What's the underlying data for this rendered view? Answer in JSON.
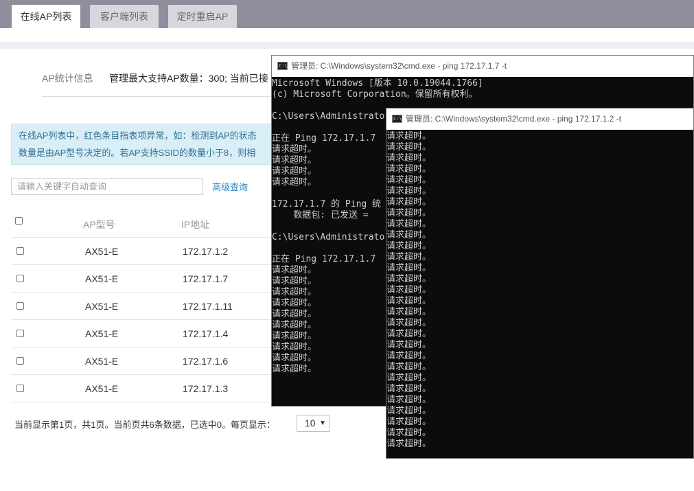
{
  "tabs": [
    "在线AP列表",
    "客户端列表",
    "定时重启AP"
  ],
  "stats": {
    "label": "AP统计信息",
    "text": "管理最大支持AP数量：300; 当前已接"
  },
  "notice": {
    "line1": "在线AP列表中，红色条目指表项异常，如：检测到AP的状态",
    "line2": "数量是由AP型号决定的。若AP支持SSID的数量小于8，则相"
  },
  "search": {
    "placeholder": "请输入关键字自动查询",
    "advanced_label": "高级查询"
  },
  "table": {
    "headers": [
      "AP型号",
      "IP地址"
    ],
    "rows": [
      {
        "model": "AX51-E",
        "ip": "172.17.1.2"
      },
      {
        "model": "AX51-E",
        "ip": "172.17.1.7"
      },
      {
        "model": "AX51-E",
        "ip": "172.17.1.11"
      },
      {
        "model": "AX51-E",
        "ip": "172.17.1.4"
      },
      {
        "model": "AX51-E",
        "ip": "172.17.1.6"
      },
      {
        "model": "AX51-E",
        "ip": "172.17.1.3"
      }
    ]
  },
  "pager": {
    "text": "当前显示第1页，共1页。当前页共6条数据，已选中0。每页显示：",
    "page_size": "10"
  },
  "cmd_windows": [
    {
      "title": "管理员: C:\\Windows\\system32\\cmd.exe - ping  172.17.1.7 -t",
      "lines": [
        "Microsoft Windows [版本 10.0.19044.1766]",
        "(c) Microsoft Corporation。保留所有权利。",
        "",
        "C:\\Users\\Administrato",
        "",
        "正在 Ping 172.17.1.7",
        "请求超时。",
        "请求超时。",
        "请求超时。",
        "请求超时。",
        "",
        "172.17.1.7 的 Ping 统",
        "    数据包: 已发送 =",
        "",
        "C:\\Users\\Administrato",
        "",
        "正在 Ping 172.17.1.7",
        "请求超时。",
        "请求超时。",
        "请求超时。",
        "请求超时。",
        "请求超时。",
        "请求超时。",
        "请求超时。",
        "请求超时。",
        "请求超时。",
        "请求超时。"
      ]
    },
    {
      "title": "管理员: C:\\Windows\\system32\\cmd.exe - ping  172.17.1.2  -t",
      "lines": [
        "请求超时。",
        "请求超时。",
        "请求超时。",
        "请求超时。",
        "请求超时。",
        "请求超时。",
        "请求超时。",
        "请求超时。",
        "请求超时。",
        "请求超时。",
        "请求超时。",
        "请求超时。",
        "请求超时。",
        "请求超时。",
        "请求超时。",
        "请求超时。",
        "请求超时。",
        "请求超时。",
        "请求超时。",
        "请求超时。",
        "请求超时。",
        "请求超时。",
        "请求超时。",
        "请求超时。",
        "请求超时。",
        "请求超时。",
        "请求超时。",
        "请求超时。",
        "请求超时。"
      ]
    }
  ]
}
